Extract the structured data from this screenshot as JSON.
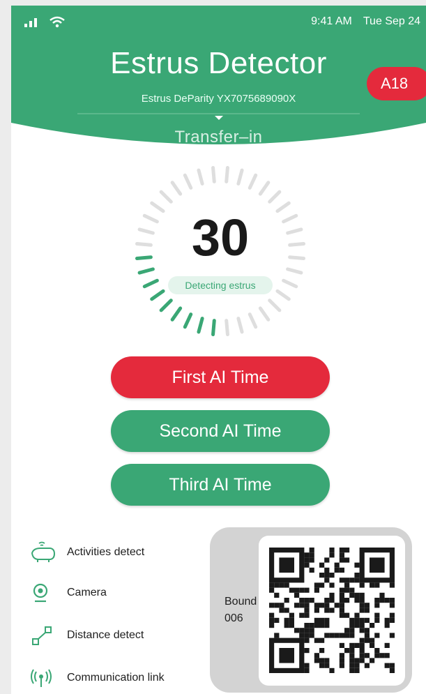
{
  "status_bar": {
    "time": "9:41 AM",
    "date": "Tue Sep 24"
  },
  "header": {
    "title": "Estrus Detector",
    "device_id": "Estrus DeParity YX7075689090X",
    "badge": "A18",
    "state": "Transfer–in"
  },
  "gauge": {
    "count": "30",
    "status": "Detecting estrus",
    "progress_fraction": 0.25
  },
  "buttons": {
    "first": "First AI Time",
    "second": "Second AI Time",
    "third": "Third AI Time"
  },
  "features": [
    {
      "label": "Activities detect",
      "icon": "pig-activity-icon"
    },
    {
      "label": "Camera",
      "icon": "camera-icon"
    },
    {
      "label": "Distance detect",
      "icon": "distance-icon"
    },
    {
      "label": "Communication link",
      "icon": "antenna-icon"
    }
  ],
  "bound": {
    "label": "Bound",
    "value": "006"
  },
  "colors": {
    "brand_green": "#3aa775",
    "alert_red": "#e42a3c",
    "tick_gray": "#dedede"
  }
}
